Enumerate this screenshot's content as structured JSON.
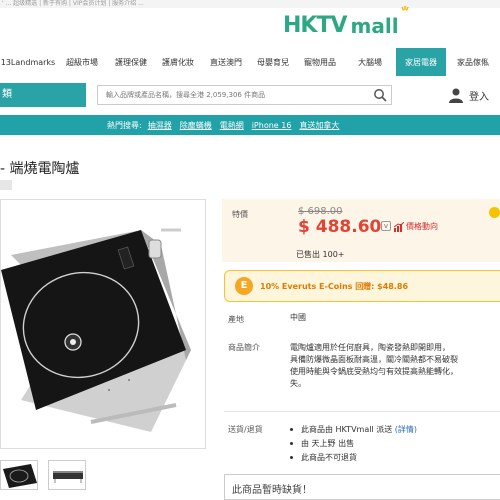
{
  "top_strip": {
    "text": "' ... 超级精选 | 新于有购 | VIP会员计划 | 服务介绍 ..."
  },
  "logo": {
    "hktv": "HKTV",
    "mall": "mall"
  },
  "categories": [
    {
      "label": "13Landmarks"
    },
    {
      "label": "超級市場"
    },
    {
      "label": "護理保健"
    },
    {
      "label": "護膚化妝"
    },
    {
      "label": "直送澳門"
    },
    {
      "label": "母嬰育兒"
    },
    {
      "label": "寵物用品"
    },
    {
      "label": "大腦場"
    },
    {
      "label": "家居電器",
      "active": true
    },
    {
      "label": "家品傢俬"
    }
  ],
  "search": {
    "department_label": "類",
    "placeholder": "輸入品牌或產品名稱，搜尋全港 2,059,306 件商品",
    "login_label": "登入"
  },
  "hot_search": {
    "label": "熱門搜尋:",
    "keywords": [
      "抽濕器",
      "除塵蟎機",
      "電熱網",
      "iPhone 16",
      "直送加拿大"
    ]
  },
  "product": {
    "title": "- 端燒電陶爐"
  },
  "price": {
    "label": "特價",
    "original": "$ 698.00",
    "current": "$ 488.60",
    "info_icon": "v",
    "trend_label": "價格動向",
    "sold": "已售出 100+"
  },
  "ecoins": {
    "icon": "E",
    "text": "10% Everuts E-Coins 回贈: $48.86"
  },
  "details": {
    "origin_label": "產地",
    "origin_value": "中國",
    "desc_label": "商品簡介",
    "desc_lines": [
      "電陶爐適用於任何廚具，陶瓷發熱即開即用，",
      "具備防爆微晶面板耐高溫，關冷關熱都不易破裂",
      "使用時能與令鍋底受熱均勻有效提高熱能轉化，",
      "失。"
    ],
    "shipping_label": "送貨/退貨",
    "shipping_items": [
      {
        "text": "此商品由 HKTVmall 派送",
        "link": "(詳情)"
      },
      {
        "text": "由 天上野 出售"
      },
      {
        "text": "此商品不可退貨"
      }
    ]
  },
  "stock": {
    "out_of_stock": "此商品暫時缺貨！"
  },
  "colors": {
    "teal": "#2aa3a6",
    "price_red": "#e34234",
    "panel_bg": "#fdf5e7",
    "ecoin_orange": "#e07b00"
  }
}
